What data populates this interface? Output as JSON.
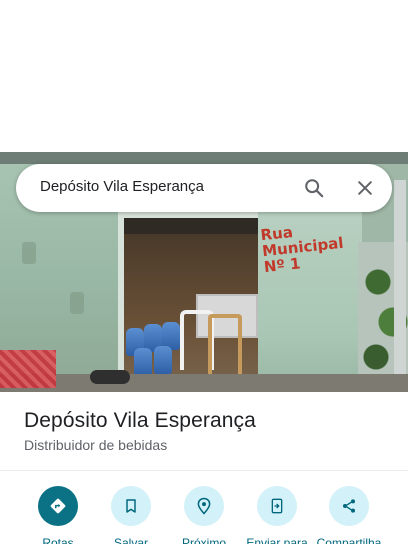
{
  "search": {
    "query": "Depósito Vila Esperança"
  },
  "photo": {
    "wall_text_line1": "Rua Municipal",
    "wall_text_line2": "Nº 1"
  },
  "place": {
    "name": "Depósito Vila Esperança",
    "category": "Distribuidor de bebidas"
  },
  "actions": [
    {
      "label": "Rotas",
      "icon": "directions-icon"
    },
    {
      "label": "Salvar",
      "icon": "bookmark-icon"
    },
    {
      "label": "Próximo",
      "icon": "nearby-icon"
    },
    {
      "label": "Enviar para",
      "icon": "send-to-phone-icon"
    },
    {
      "label": "Compartilha",
      "icon": "share-icon"
    }
  ],
  "colors": {
    "primary": "#0b7285",
    "action_bg": "#d2f1f8",
    "action_text": "#00677d"
  }
}
